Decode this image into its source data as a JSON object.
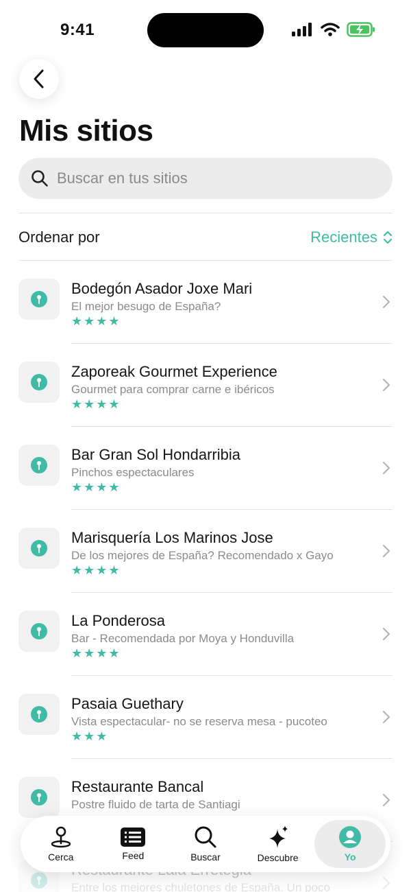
{
  "status_bar": {
    "time": "9:41"
  },
  "header": {
    "back_icon": "chevron-left-icon",
    "title": "Mis sitios"
  },
  "search": {
    "placeholder": "Buscar en tus sitios",
    "value": ""
  },
  "sort": {
    "label": "Ordenar por",
    "selected": "Recientes"
  },
  "colors": {
    "accent": "#3fbba6"
  },
  "places": [
    {
      "name": "Bodegón Asador Joxe Mari",
      "note": "El mejor besugo de España?",
      "rating": 4
    },
    {
      "name": "Zaporeak Gourmet Experience",
      "note": "Gourmet para comprar carne e ibéricos",
      "rating": 4
    },
    {
      "name": "Bar Gran Sol Hondarribia",
      "note": "Pinchos espectaculares",
      "rating": 4
    },
    {
      "name": "Marisquería Los Marinos Jose",
      "note": "De los mejores de España? Recomendado x Gayo",
      "rating": 4
    },
    {
      "name": "La Ponderosa",
      "note": "Bar - Recomendada por Moya y Honduvilla",
      "rating": 4
    },
    {
      "name": "Pasaia Guethary",
      "note": "Vista espectacular- no se reserva mesa - pucoteo",
      "rating": 3
    },
    {
      "name": "Restaurante Bancal",
      "note": "Postre fluido de tarta de Santiagi",
      "rating": null
    },
    {
      "name": "Restaurante Laia Erretegia",
      "note": "Entre los mejores chuletones de España. Un poco",
      "rating": null
    }
  ],
  "tab_bar": {
    "tabs": [
      {
        "label": "Cerca",
        "icon": "map-pin-icon",
        "active": false
      },
      {
        "label": "Feed",
        "icon": "feed-icon",
        "active": false
      },
      {
        "label": "Buscar",
        "icon": "search-icon",
        "active": false
      },
      {
        "label": "Descubre",
        "icon": "sparkles-icon",
        "active": false
      },
      {
        "label": "Yo",
        "icon": "profile-icon",
        "active": true
      }
    ]
  }
}
